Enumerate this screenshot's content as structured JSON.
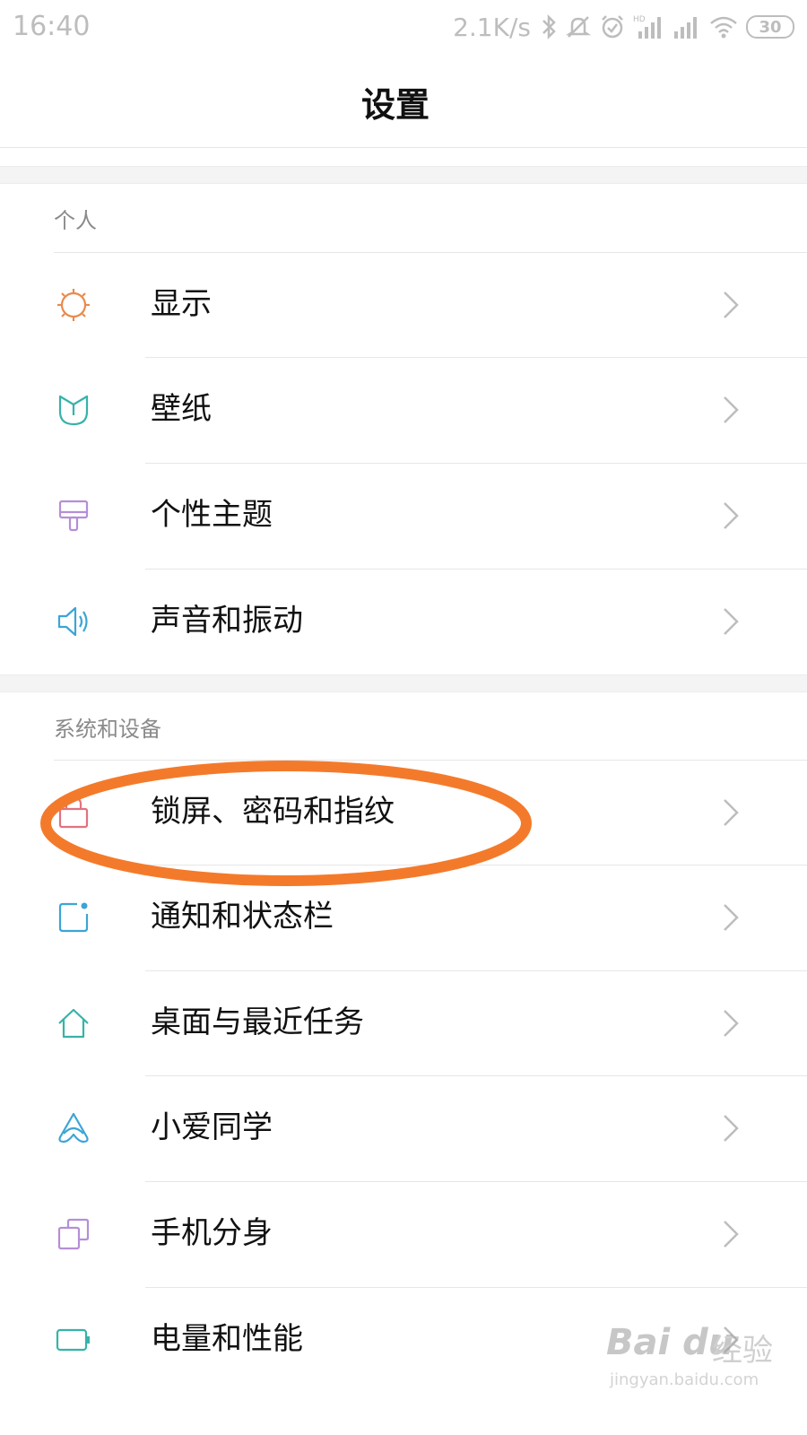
{
  "status_bar": {
    "time": "16:40",
    "net_speed": "2.1K/s",
    "battery": "30",
    "icons": [
      "bluetooth-icon",
      "mute-icon",
      "alarm-icon",
      "signal-hd-icon",
      "signal-icon",
      "wifi-icon",
      "battery-icon"
    ]
  },
  "header": {
    "title": "设置"
  },
  "sections": [
    {
      "title": "个人",
      "items": [
        {
          "label": "显示",
          "icon": "brightness-icon",
          "color": "#e88b4e"
        },
        {
          "label": "壁纸",
          "icon": "wallpaper-icon",
          "color": "#36b3a8"
        },
        {
          "label": "个性主题",
          "icon": "theme-brush-icon",
          "color": "#b48fd8"
        },
        {
          "label": "声音和振动",
          "icon": "speaker-icon",
          "color": "#3da4d6"
        }
      ]
    },
    {
      "title": "系统和设备",
      "items": [
        {
          "label": "锁屏、密码和指纹",
          "icon": "lock-icon",
          "color": "#e2727f"
        },
        {
          "label": "通知和状态栏",
          "icon": "notification-icon",
          "color": "#3da4d6"
        },
        {
          "label": "桌面与最近任务",
          "icon": "home-icon",
          "color": "#36b3a8"
        },
        {
          "label": "小爱同学",
          "icon": "xiaoai-icon",
          "color": "#3da4d6"
        },
        {
          "label": "手机分身",
          "icon": "second-space-icon",
          "color": "#b48fd8"
        },
        {
          "label": "电量和性能",
          "icon": "battery-performance-icon",
          "color": "#36b3a8"
        }
      ]
    }
  ],
  "annotation": {
    "highlight_color": "#f47a2b",
    "highlighted_item": "锁屏、密码和指纹"
  },
  "watermark": {
    "brand": "Bai du",
    "cn": "经验",
    "url": "jingyan.baidu.com"
  }
}
